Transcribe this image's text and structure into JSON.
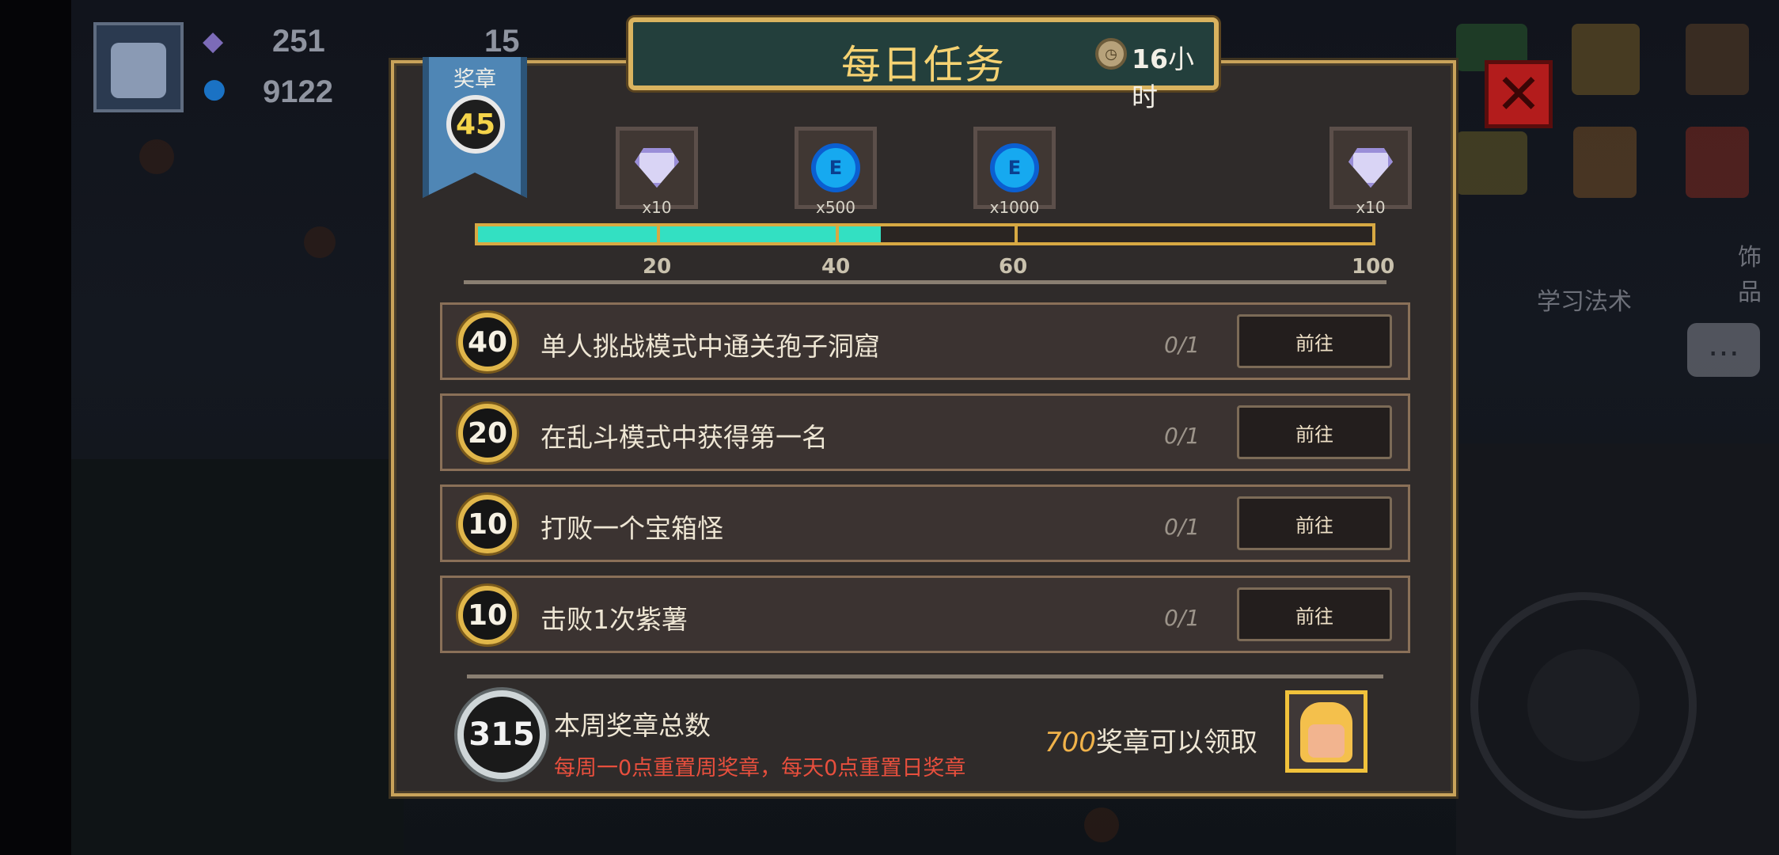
{
  "hud": {
    "gems_value": "251",
    "coins_value": "9122",
    "keys_value": "15"
  },
  "dialog": {
    "title": "每日任务",
    "timer_hours": "16",
    "timer_unit": "小时",
    "ribbon_label": "奖章",
    "current_medals": "45"
  },
  "rewards": [
    {
      "icon": "diamond-icon",
      "qty": "x10",
      "threshold": "20"
    },
    {
      "icon": "blue-coin-icon",
      "qty": "x500",
      "threshold": "40"
    },
    {
      "icon": "blue-coin-icon",
      "qty": "x1000",
      "threshold": "60"
    },
    {
      "icon": "diamond-icon",
      "qty": "x10",
      "threshold": "100"
    }
  ],
  "progress": {
    "current": 45,
    "max": 100,
    "fill_color": "#33e0c2",
    "border_color": "#d7a943"
  },
  "tasks": [
    {
      "medals": "40",
      "text": "单人挑战模式中通关孢子洞窟",
      "progress": "0/1",
      "button": "前往"
    },
    {
      "medals": "20",
      "text": "在乱斗模式中获得第一名",
      "progress": "0/1",
      "button": "前往"
    },
    {
      "medals": "10",
      "text": "打败一个宝箱怪",
      "progress": "0/1",
      "button": "前往"
    },
    {
      "medals": "10",
      "text": "击败1次紫薯",
      "progress": "0/1",
      "button": "前往"
    }
  ],
  "footer": {
    "weekly_total": "315",
    "weekly_title": "本周奖章总数",
    "reset_note": "每周一0点重置周奖章，每天0点重置日奖章",
    "claim_amount": "700",
    "claim_text": "奖章可以领取"
  },
  "side": {
    "accessory_label": "饰品",
    "learn_spell_label": "学习法术"
  },
  "colors": {
    "accent_gold": "#d9b35f",
    "title_text": "#f5d272",
    "warning_red": "#e84f3d",
    "close_red": "#b31c1c"
  }
}
